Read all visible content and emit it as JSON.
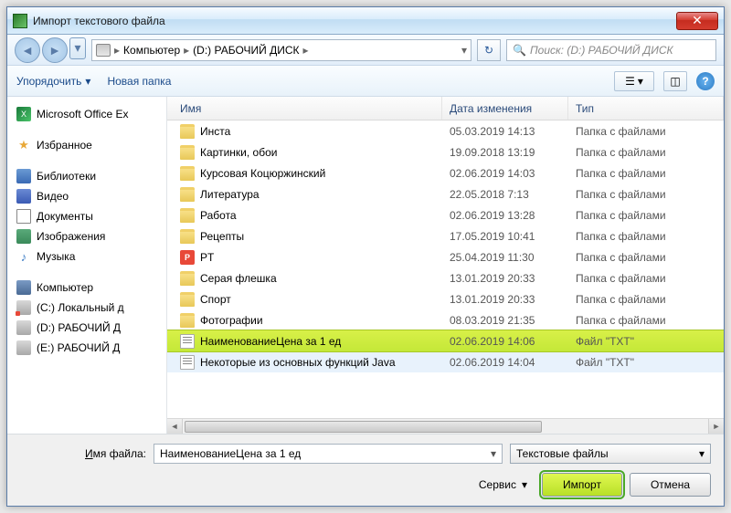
{
  "title": "Импорт текстового файла",
  "breadcrumb": {
    "root": "Компьютер",
    "path": "(D:) РАБОЧИЙ ДИСК"
  },
  "search_placeholder": "Поиск: (D:) РАБОЧИЙ ДИСК",
  "toolbar": {
    "organize": "Упорядочить",
    "new_folder": "Новая папка"
  },
  "sidebar": {
    "office": "Microsoft Office Ex",
    "favorites": "Избранное",
    "libraries": "Библиотеки",
    "video": "Видео",
    "documents": "Документы",
    "images": "Изображения",
    "music": "Музыка",
    "computer": "Компьютер",
    "c": "(C:) Локальный д",
    "d": "(D:) РАБОЧИЙ Д",
    "e": "(E:) РАБОЧИЙ Д"
  },
  "columns": {
    "name": "Имя",
    "date": "Дата изменения",
    "type": "Тип"
  },
  "rows": [
    {
      "icon": "folder",
      "name": "Инста",
      "date": "05.03.2019 14:13",
      "type": "Папка с файлами"
    },
    {
      "icon": "folder",
      "name": "Картинки, обои",
      "date": "19.09.2018 13:19",
      "type": "Папка с файлами"
    },
    {
      "icon": "folder",
      "name": "Курсовая Коцюржинский",
      "date": "02.06.2019 14:03",
      "type": "Папка с файлами"
    },
    {
      "icon": "folder",
      "name": "Литература",
      "date": "22.05.2018 7:13",
      "type": "Папка с файлами"
    },
    {
      "icon": "folder",
      "name": "Работа",
      "date": "02.06.2019 13:28",
      "type": "Папка с файлами"
    },
    {
      "icon": "folder",
      "name": "Рецепты",
      "date": "17.05.2019 10:41",
      "type": "Папка с файлами"
    },
    {
      "icon": "pt",
      "name": "PT",
      "date": "25.04.2019 11:30",
      "type": "Папка с файлами"
    },
    {
      "icon": "folder",
      "name": "Серая флешка",
      "date": "13.01.2019 20:33",
      "type": "Папка с файлами"
    },
    {
      "icon": "folder",
      "name": "Спорт",
      "date": "13.01.2019 20:33",
      "type": "Папка с файлами"
    },
    {
      "icon": "folder",
      "name": "Фотографии",
      "date": "08.03.2019 21:35",
      "type": "Папка с файлами"
    },
    {
      "icon": "txt",
      "name": "НаименованиеЦена за 1 ед",
      "date": "02.06.2019 14:06",
      "type": "Файл \"TXT\"",
      "selected": true
    },
    {
      "icon": "txt",
      "name": "Некоторые из основных функций Java",
      "date": "02.06.2019 14:04",
      "type": "Файл \"TXT\"",
      "highlighted": true
    }
  ],
  "filename_label": "Имя файла:",
  "filename_value": "НаименованиеЦена за 1 ед",
  "filter": "Текстовые файлы",
  "service": "Сервис",
  "import_btn": "Импорт",
  "cancel_btn": "Отмена"
}
